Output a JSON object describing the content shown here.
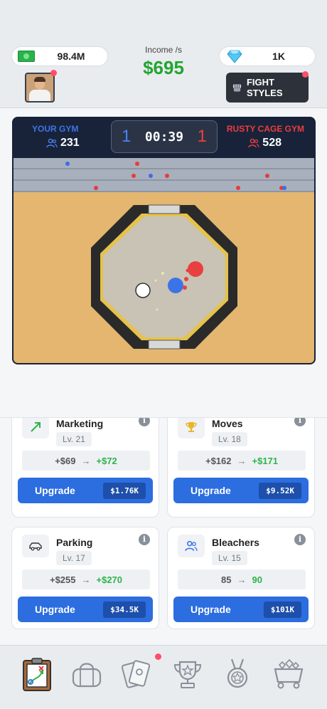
{
  "header": {
    "cash": "98.4M",
    "gems": "1K",
    "income_label": "Income /s",
    "income_value": "$695",
    "fight_styles_label": "FIGHT STYLES"
  },
  "match": {
    "your_gym_label": "YOUR GYM",
    "your_fans": "231",
    "opponent_label": "RUSTY CAGE GYM",
    "opponent_fans": "528",
    "score_left": "1",
    "score_right": "1",
    "timer": "00:39"
  },
  "cards": [
    {
      "title": "Marketing",
      "level": "Lv. 21",
      "from": "+$69",
      "to": "+$72",
      "upgrade_label": "Upgrade",
      "price": "$1.76K",
      "icon": "trend-arrow-icon"
    },
    {
      "title": "Moves",
      "level": "Lv. 18",
      "from": "+$162",
      "to": "+$171",
      "upgrade_label": "Upgrade",
      "price": "$9.52K",
      "icon": "trophy-icon"
    },
    {
      "title": "Parking",
      "level": "Lv. 17",
      "from": "+$255",
      "to": "+$270",
      "upgrade_label": "Upgrade",
      "price": "$34.5K",
      "icon": "car-icon"
    },
    {
      "title": "Bleachers",
      "level": "Lv. 15",
      "from": "85",
      "to": "90",
      "upgrade_label": "Upgrade",
      "price": "$101K",
      "icon": "people-icon"
    }
  ],
  "nav": [
    "clipboard-strategy-icon",
    "gym-bag-icon",
    "cards-icon",
    "trophy-cup-icon",
    "medal-icon",
    "treasure-cart-icon"
  ],
  "colors": {
    "accent_blue": "#2c6de0",
    "income_green": "#22a52f",
    "team_blue": "#3d74e6",
    "team_red": "#ee3c3c",
    "notification_red": "#ff4d6a"
  }
}
